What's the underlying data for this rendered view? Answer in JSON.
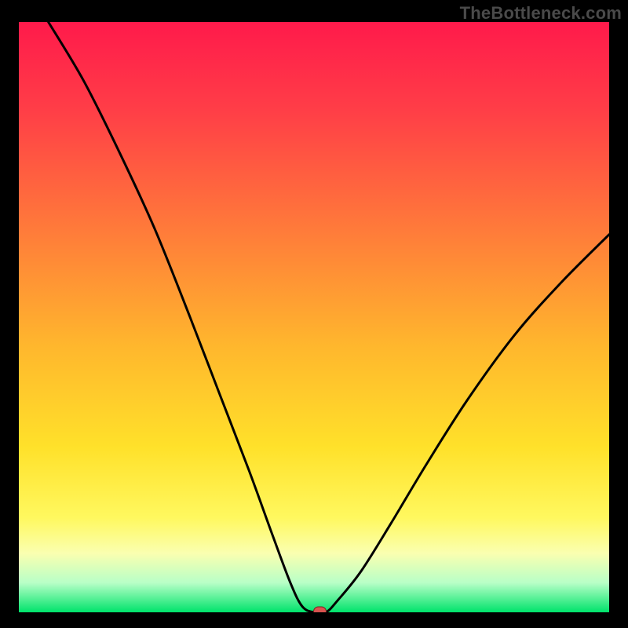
{
  "watermark": "TheBottleneck.com",
  "chart_data": {
    "type": "line",
    "title": "",
    "xlabel": "",
    "ylabel": "",
    "xlim": [
      0,
      100
    ],
    "ylim": [
      0,
      100
    ],
    "grid": false,
    "gradient_stops": [
      {
        "offset": 0.0,
        "color": "#ff1a4b"
      },
      {
        "offset": 0.15,
        "color": "#ff3e47"
      },
      {
        "offset": 0.35,
        "color": "#ff7a3a"
      },
      {
        "offset": 0.55,
        "color": "#ffb72d"
      },
      {
        "offset": 0.72,
        "color": "#ffe12a"
      },
      {
        "offset": 0.84,
        "color": "#fff85f"
      },
      {
        "offset": 0.9,
        "color": "#faffb0"
      },
      {
        "offset": 0.95,
        "color": "#b8ffc7"
      },
      {
        "offset": 1.0,
        "color": "#00e36b"
      }
    ],
    "curve": [
      {
        "x": 5,
        "y": 100
      },
      {
        "x": 11,
        "y": 90
      },
      {
        "x": 17,
        "y": 78
      },
      {
        "x": 23,
        "y": 65
      },
      {
        "x": 29,
        "y": 50
      },
      {
        "x": 34,
        "y": 37
      },
      {
        "x": 39,
        "y": 24
      },
      {
        "x": 43,
        "y": 13
      },
      {
        "x": 46,
        "y": 5
      },
      {
        "x": 48,
        "y": 1
      },
      {
        "x": 50,
        "y": 0
      },
      {
        "x": 52,
        "y": 0
      },
      {
        "x": 54,
        "y": 2
      },
      {
        "x": 58,
        "y": 7
      },
      {
        "x": 63,
        "y": 15
      },
      {
        "x": 69,
        "y": 25
      },
      {
        "x": 76,
        "y": 36
      },
      {
        "x": 84,
        "y": 47
      },
      {
        "x": 92,
        "y": 56
      },
      {
        "x": 100,
        "y": 64
      }
    ],
    "marker": {
      "x": 51,
      "y": 0,
      "color": "#d9534f"
    }
  }
}
